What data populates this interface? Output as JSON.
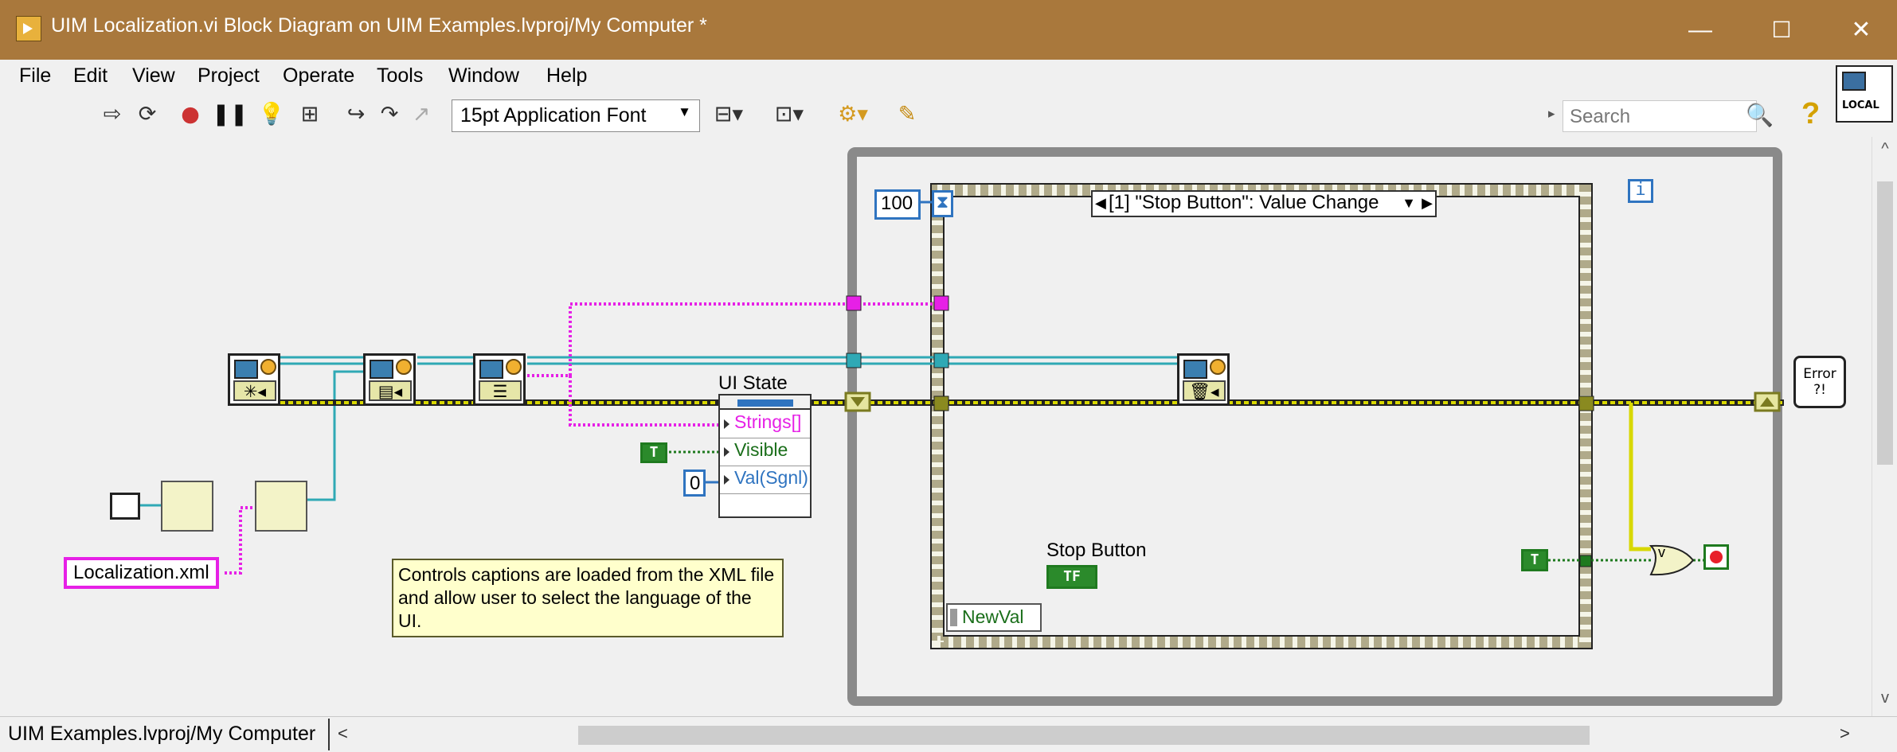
{
  "window": {
    "title": "UIM Localization.vi Block Diagram on UIM Examples.lvproj/My Computer *",
    "minimize": "—",
    "maximize": "☐",
    "close": "✕"
  },
  "menu": [
    "File",
    "Edit",
    "View",
    "Project",
    "Operate",
    "Tools",
    "Window",
    "Help"
  ],
  "toolbar": {
    "font_select": "15pt Application Font",
    "search_placeholder": "Search"
  },
  "corner_badge": "LOCAL",
  "diagram": {
    "timeout_value": "100",
    "event_case_label": "[1] \"Stop Button\": Value Change",
    "iteration_terminal": "i",
    "ui_state_label": "UI State",
    "unbundle_elements": [
      "Strings[]",
      "Visible",
      "Val(Sgnl)"
    ],
    "true_constant": "T",
    "zero_constant": "0",
    "file_constant": "Localization.xml",
    "comment": "Controls captions are loaded from the XML file and allow user to select the language of the UI.",
    "stop_button_label": "Stop Button",
    "stop_button_terminal": "TF",
    "event_data_node": "NewVal",
    "or_gate": "v",
    "error_node": "Error ?!",
    "node_glyphs": {
      "init": "✳◂",
      "load": "▤◂",
      "list": "☰",
      "destroy": "🗑◂"
    }
  },
  "status": {
    "path": "UIM Examples.lvproj/My Computer"
  },
  "colors": {
    "titlebar": "#a9783c",
    "error_wire": "#c4c400",
    "reference_wire": "#2fa9b5",
    "string_wire": "#e620e6",
    "boolean_wire": "#1f7a1f",
    "numeric_blue": "#2f74c0"
  }
}
